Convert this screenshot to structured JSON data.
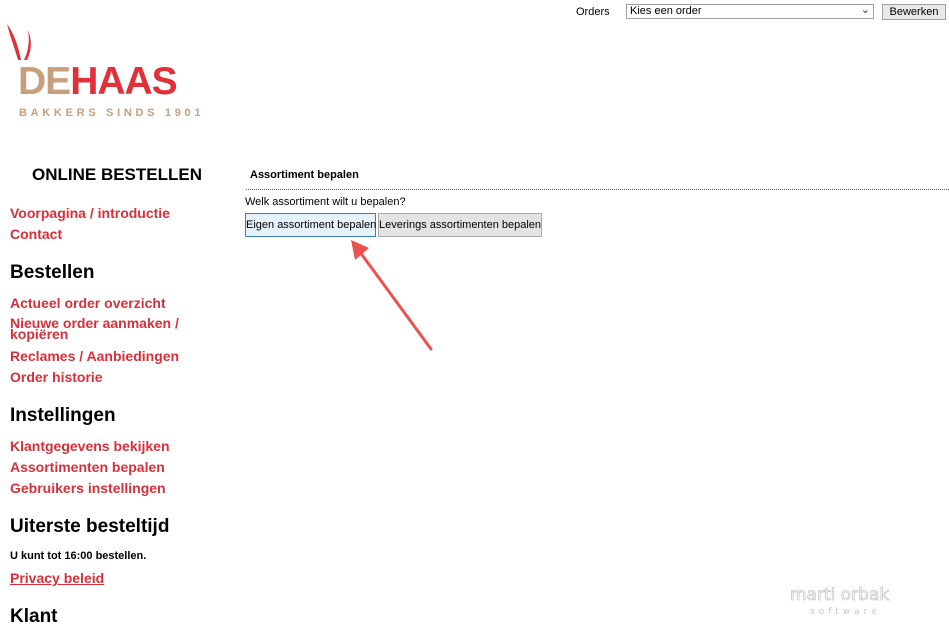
{
  "header": {
    "orders_label": "Orders",
    "orders_select_value": "Kies een order",
    "edit_button": "Bewerken"
  },
  "logo": {
    "word_prefix": "DE",
    "word_main": "HAAS",
    "tagline": "BAKKERS SINDS 1901"
  },
  "sidebar": {
    "title": "ONLINE BESTELLEN",
    "intro_links": [
      "Voorpagina / introductie",
      "Contact"
    ],
    "section_order": {
      "heading": "Bestellen",
      "links": [
        "Actueel order overzicht",
        "Nieuwe order aanmaken / kopiëren",
        "Reclames / Aanbiedingen",
        "Order historie"
      ]
    },
    "section_settings": {
      "heading": "Instellingen",
      "links": [
        "Klantgegevens bekijken",
        "Assortimenten bepalen",
        "Gebruikers instellingen"
      ]
    },
    "section_deadline": {
      "heading": "Uiterste besteltijd",
      "note": "U kunt tot 16:00 bestellen.",
      "privacy_link": "Privacy beleid"
    },
    "section_customer": {
      "heading": "Klant"
    }
  },
  "main": {
    "title": "Assortiment bepalen",
    "question": "Welk assortiment wilt u bepalen?",
    "own_button": "Eigen assortiment bepalen",
    "delivery_button": "Leverings assortimenten bepalen"
  },
  "watermark": {
    "name": "marti orbak",
    "sub": "software"
  },
  "colors": {
    "brand_red": "#e0313b",
    "brand_tan": "#c89f7d",
    "link_red": "#d8303a",
    "arrow_red": "#ee5050"
  }
}
